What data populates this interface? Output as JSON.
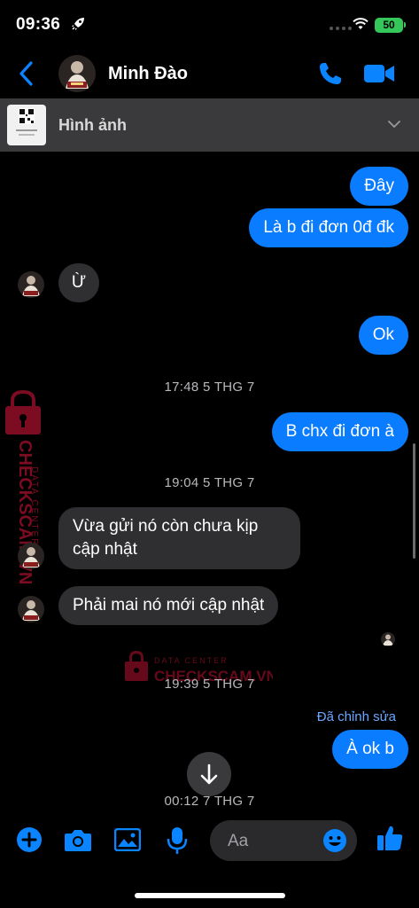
{
  "status_bar": {
    "time": "09:36",
    "battery": "50"
  },
  "header": {
    "contact_name": "Minh Đào"
  },
  "pinned": {
    "label": "Hình ảnh"
  },
  "messages": [
    {
      "text": "Đây"
    },
    {
      "text": "Là b đi đơn 0đ đk"
    },
    {
      "text": "Ừ"
    },
    {
      "text": "Ok"
    },
    {
      "text": "B chx đi đơn à"
    },
    {
      "text": "Vừa gửi nó còn chưa kịp cập nhật"
    },
    {
      "text": "Phải mai nó mới cập nhật"
    },
    {
      "text": "À ok b"
    }
  ],
  "timestamps": [
    "17:48 5 THG 7",
    "19:04 5 THG 7",
    "19:39 5 THG 7",
    "00:12 7 THG 7"
  ],
  "edited_label": "Đã chỉnh sửa",
  "watermark": {
    "brand": "CHECKSCAM.VN",
    "tagline": "DATA CENTER"
  },
  "composer": {
    "placeholder": "Aa"
  },
  "colors": {
    "accent": "#0a7cff",
    "incoming": "#2f2f31",
    "watermark": "#e0163c"
  }
}
